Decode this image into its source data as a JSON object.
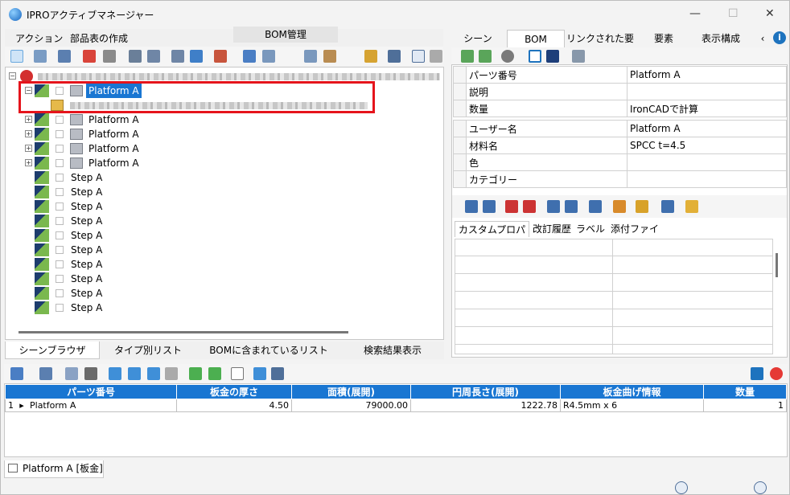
{
  "window": {
    "title": "IPROアクティブマネージャー",
    "minimize": "—",
    "maximize": "☐",
    "close": "✕"
  },
  "menu": {
    "items": [
      "アクション",
      "部品表の作成"
    ],
    "bom_tab": "BOM管理"
  },
  "tree": {
    "selected": {
      "label": "Platform A"
    },
    "platforms": [
      "Platform A",
      "Platform A",
      "Platform A",
      "Platform A"
    ],
    "steps": [
      "Step A",
      "Step A",
      "Step A",
      "Step A",
      "Step A",
      "Step A",
      "Step A",
      "Step A",
      "Step A",
      "Step A"
    ]
  },
  "left_tabs": [
    "シーンブラウザ",
    "タイプ別リスト",
    "BOMに含まれているリスト",
    "検索結果表示"
  ],
  "right_tabs": [
    "シーン",
    "BOM",
    "リンクされた要素",
    "要素",
    "表示構成"
  ],
  "props1": [
    {
      "k": "パーツ番号",
      "v": "Platform A"
    },
    {
      "k": "説明",
      "v": ""
    },
    {
      "k": "数量",
      "v": "IronCADで計算"
    }
  ],
  "props2": [
    {
      "k": "ユーザー名",
      "v": "Platform A"
    },
    {
      "k": "材料名",
      "v": "SPCC t=4.5"
    },
    {
      "k": "色",
      "v": ""
    },
    {
      "k": "カテゴリー",
      "v": ""
    }
  ],
  "sub_tabs": [
    "カスタムプロパティ",
    "改訂履歴",
    "ラベル",
    "添付ファイル"
  ],
  "grid": {
    "headers": [
      "パーツ番号",
      "板金の厚さ",
      "面積(展開)",
      "円周長さ(展開)",
      "板金曲げ情報",
      "数量"
    ],
    "rows": [
      {
        "idx": "1",
        "part": "Platform A",
        "thick": "4.50",
        "area": "79000.00",
        "perim": "1222.78",
        "bend": "R4.5mm x 6",
        "qty": "1"
      }
    ]
  },
  "bottom_tab": "Platform A [板金]",
  "colors": {
    "accent": "#1976d2",
    "highlight": "#e5141c"
  }
}
